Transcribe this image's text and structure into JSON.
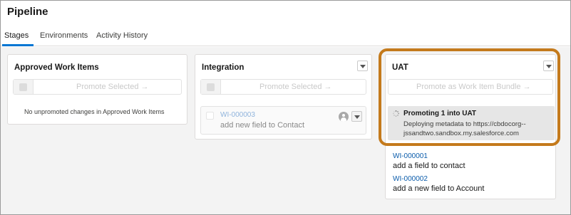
{
  "page": {
    "title": "Pipeline"
  },
  "tabs": [
    {
      "label": "Stages",
      "active": true
    },
    {
      "label": "Environments",
      "active": false
    },
    {
      "label": "Activity History",
      "active": false
    }
  ],
  "columns": {
    "approved": {
      "title": "Approved Work Items",
      "promote_label": "Promote Selected →",
      "empty_message": "No unpromoted changes in Approved Work Items"
    },
    "integration": {
      "title": "Integration",
      "promote_label": "Promote Selected →",
      "items": [
        {
          "id": "WI-000003",
          "description": "add new field to Contact"
        }
      ]
    },
    "uat": {
      "title": "UAT",
      "promote_label": "Promote as Work Item Bundle →",
      "status": {
        "title": "Promoting 1 into UAT",
        "line1": "Deploying metadata to https://cbdocorg--",
        "line2": "jssandtwo.sandbox.my.salesforce.com"
      },
      "items": [
        {
          "id": "WI-000001",
          "description": "add a field to contact"
        },
        {
          "id": "WI-000002",
          "description": "add a new field to Account"
        }
      ]
    }
  },
  "colors": {
    "accent": "#0176d3",
    "link": "#0b5cab",
    "highlight": "#c47a1c"
  }
}
